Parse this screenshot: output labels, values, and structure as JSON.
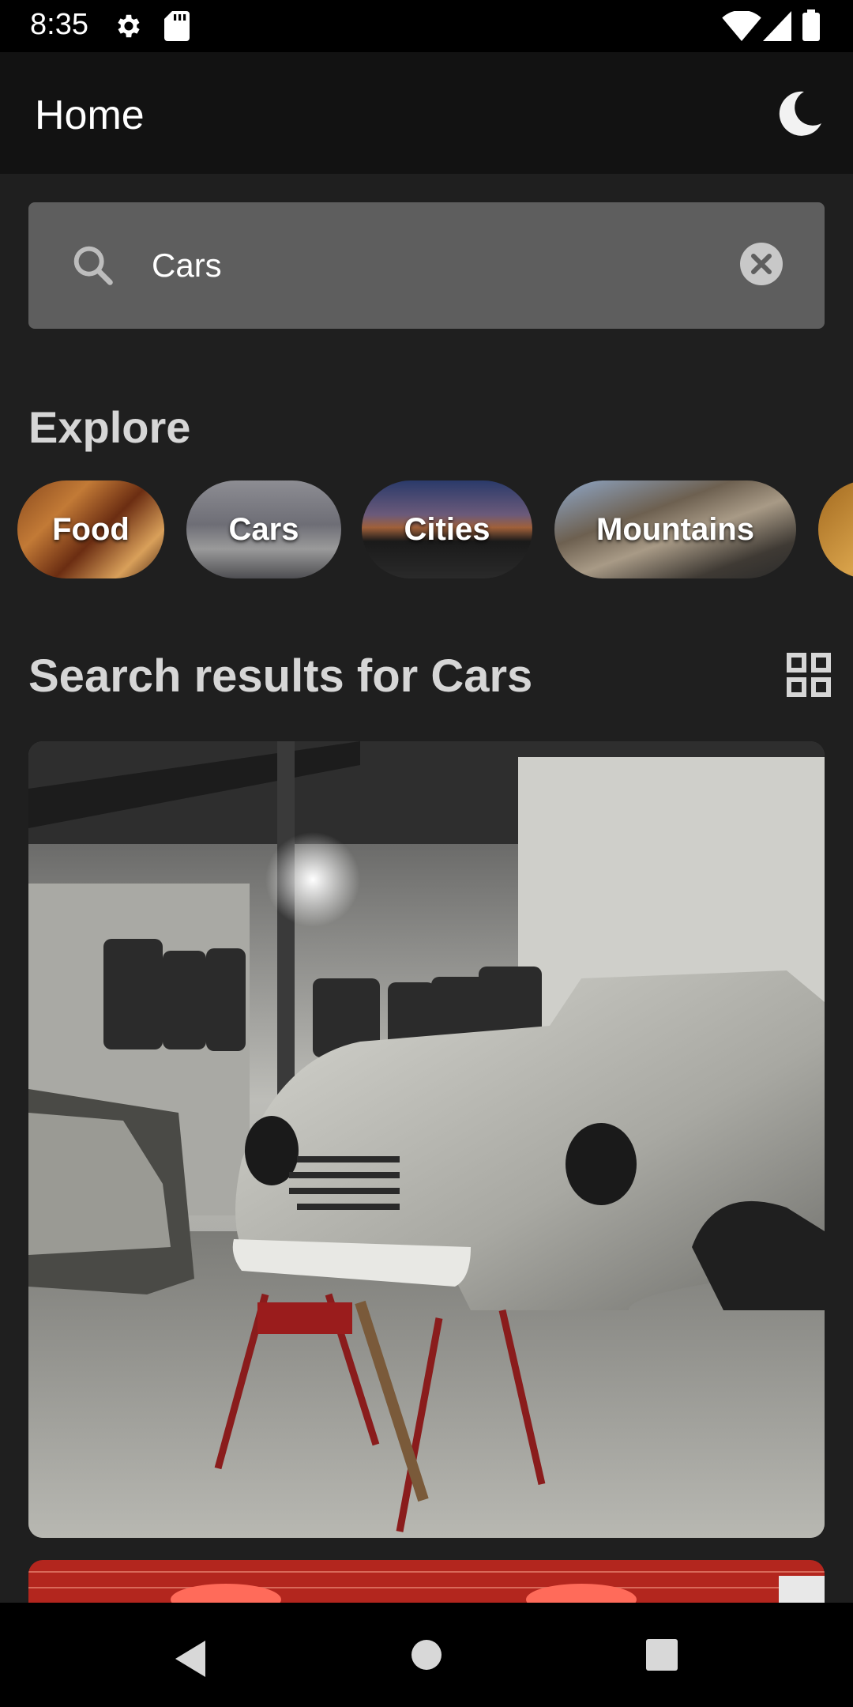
{
  "status_bar": {
    "time": "8:35",
    "icons": [
      "gear-icon",
      "sd-card-icon",
      "wifi-icon",
      "signal-icon",
      "battery-icon"
    ]
  },
  "app_bar": {
    "title": "Home",
    "theme_icon": "moon-icon"
  },
  "search": {
    "value": "Cars",
    "icons": [
      "search-icon",
      "clear-icon"
    ]
  },
  "explore": {
    "title": "Explore",
    "chips": [
      {
        "label": "Food"
      },
      {
        "label": "Cars"
      },
      {
        "label": "Cities"
      },
      {
        "label": "Mountains"
      }
    ]
  },
  "results": {
    "title": "Search results for Cars",
    "layout_icon": "grid-view-icon"
  },
  "colors": {
    "background": "#1f1f1f",
    "app_bar": "#121212",
    "search_box": "#5e5e5e",
    "heading_text": "#d6d6d6"
  }
}
